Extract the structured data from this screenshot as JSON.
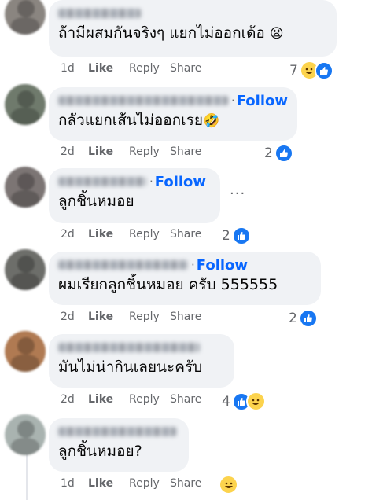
{
  "colors": {
    "link_blue": "#0866ff",
    "like_blue": "#1877f2",
    "bubble_bg": "#f0f2f5",
    "meta_gray": "#65676b"
  },
  "labels": {
    "like": "Like",
    "reply": "Reply",
    "share": "Share",
    "follow": "Follow"
  },
  "comments": [
    {
      "text": "ถ้ามีผสมกันจริงๆ แยกไม่ออกเด้อ",
      "text_emoji": "😫",
      "time": "1d",
      "reaction_count": "7",
      "reactions": [
        "haha",
        "like"
      ],
      "has_follow": false,
      "avatar_color": "#8a8580"
    },
    {
      "text": "กลัวแยกเส้นไม่ออกเรย",
      "text_emoji": "🤣",
      "time": "2d",
      "reaction_count": "2",
      "reactions": [
        "like"
      ],
      "has_follow": true,
      "avatar_color": "#6f7a6c"
    },
    {
      "text": "ลูกชิ้นหมอย",
      "text_emoji": "",
      "time": "2d",
      "reaction_count": "2",
      "reactions": [
        "like"
      ],
      "has_follow": true,
      "avatar_color": "#7c7574",
      "has_more_menu": true
    },
    {
      "text": "ผมเรียกลูกชิ้นหมอย ครับ 555555",
      "text_emoji": "",
      "time": "2d",
      "reaction_count": "2",
      "reactions": [
        "like"
      ],
      "has_follow": true,
      "avatar_color": "#6d6e6a"
    },
    {
      "text": "มันไม่น่ากินเลยนะครับ",
      "text_emoji": "",
      "time": "2d",
      "reaction_count": "4",
      "reactions": [
        "like",
        "haha"
      ],
      "has_follow": false,
      "avatar_color": "#b07a52"
    },
    {
      "text": "ลูกชิ้นหมอย?",
      "text_emoji": "",
      "time": "1d",
      "reaction_count": "",
      "reactions": [
        "haha"
      ],
      "has_follow": false,
      "avatar_color": "#a9b3b0"
    }
  ]
}
